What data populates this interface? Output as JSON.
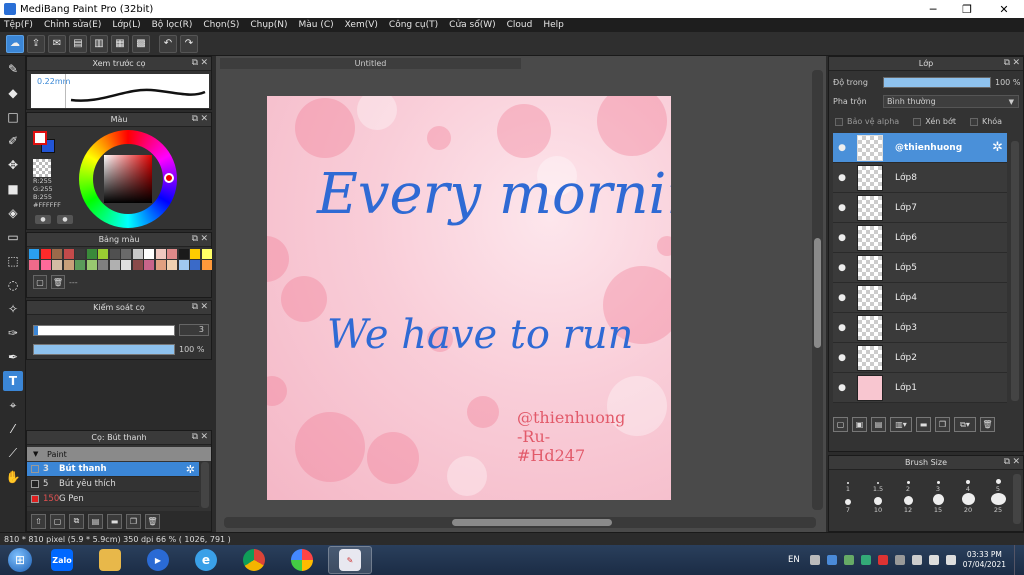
{
  "window": {
    "title": "MediBang Paint Pro (32bit)"
  },
  "menu": [
    "Tệp(F)",
    "Chỉnh sửa(E)",
    "Lớp(L)",
    "Bộ lọc(R)",
    "Chọn(S)",
    "Chụp(N)",
    "Màu (C)",
    "Xem(V)",
    "Công cụ(T)",
    "Cửa sổ(W)",
    "Cloud",
    "Help"
  ],
  "panels": {
    "preview": {
      "title": "Xem trước cọ",
      "value": "0.22mm"
    },
    "color": {
      "title": "Màu",
      "r": "R:255",
      "g": "G:255",
      "b": "B:255",
      "hex": "#FFFFFF",
      "fg": "#ffffff",
      "bg": "#2255d6",
      "accent": "#e01010"
    },
    "palette": {
      "title": "Bảng màu",
      "tool_label": "---",
      "colors": [
        "#2aa0f0",
        "#ff2a2a",
        "#9a6a4a",
        "#c44a4a",
        "#3a3a3a",
        "#3a8a3a",
        "#9acd32",
        "#505050",
        "#6a6a6a",
        "#c8c8c8",
        "#ffffff",
        "#f0c8c0",
        "#e08a8a",
        "#1a1a1a",
        "#ffcc00",
        "#ffff66",
        "#f06a8a",
        "#ff6a9a",
        "#d4bca4",
        "#c8a07a",
        "#5a9a5a",
        "#98c870",
        "#808080",
        "#b0b0b0",
        "#e0e0e0",
        "#8a4a4a",
        "#c8648a",
        "#e0a080",
        "#f0d0b0",
        "#a0c8f0",
        "#3a6ac8",
        "#ff9a3a"
      ]
    },
    "brush_control": {
      "title": "Kiểm soát cọ",
      "size_value": "3",
      "opacity_value": "100 %"
    },
    "brush_list": {
      "title": "Cọ: Bút thanh",
      "group": "Paint",
      "items": [
        {
          "size": "3",
          "name": "Bút thanh"
        },
        {
          "size": "5",
          "name": "Bút yêu thích"
        },
        {
          "size": "150",
          "name": "G Pen"
        }
      ]
    },
    "layer": {
      "title": "Lớp",
      "opacity_label": "Độ trong",
      "opacity_value": "100 %",
      "opacity_level": 1.0,
      "blend_label": "Pha trộn",
      "blend_value": "Bình thường",
      "protect_alpha": "Bảo vệ alpha",
      "clipping": "Xén bớt",
      "lock": "Khóa",
      "layers": [
        "@thienhuong",
        "Lớp8",
        "Lớp7",
        "Lớp6",
        "Lớp5",
        "Lớp4",
        "Lớp3",
        "Lớp2",
        "Lớp1"
      ]
    },
    "brush_size": {
      "title": "Brush Size",
      "sizes": [
        "1",
        "1.5",
        "2",
        "3",
        "4",
        "5",
        "7",
        "10",
        "12",
        "15",
        "20",
        "25"
      ]
    }
  },
  "document": {
    "tab": "Untitled",
    "line1": "Every morning",
    "line2": "We have to run",
    "sig1": "@thienhuong",
    "sig2": "-Ru-",
    "sig3": "#Hd247"
  },
  "status": "810 * 810 pixel  (5.9 * 5.9cm)  350 dpi  66 %  ( 1026, 791 )",
  "taskbar": {
    "lang": "EN",
    "time": "03:33 PM",
    "date": "07/04/2021",
    "apps": [
      "Zalo",
      "Explorer",
      "Media Player",
      "Internet Explorer",
      "Chrome",
      "Photos",
      "MediBang"
    ]
  }
}
